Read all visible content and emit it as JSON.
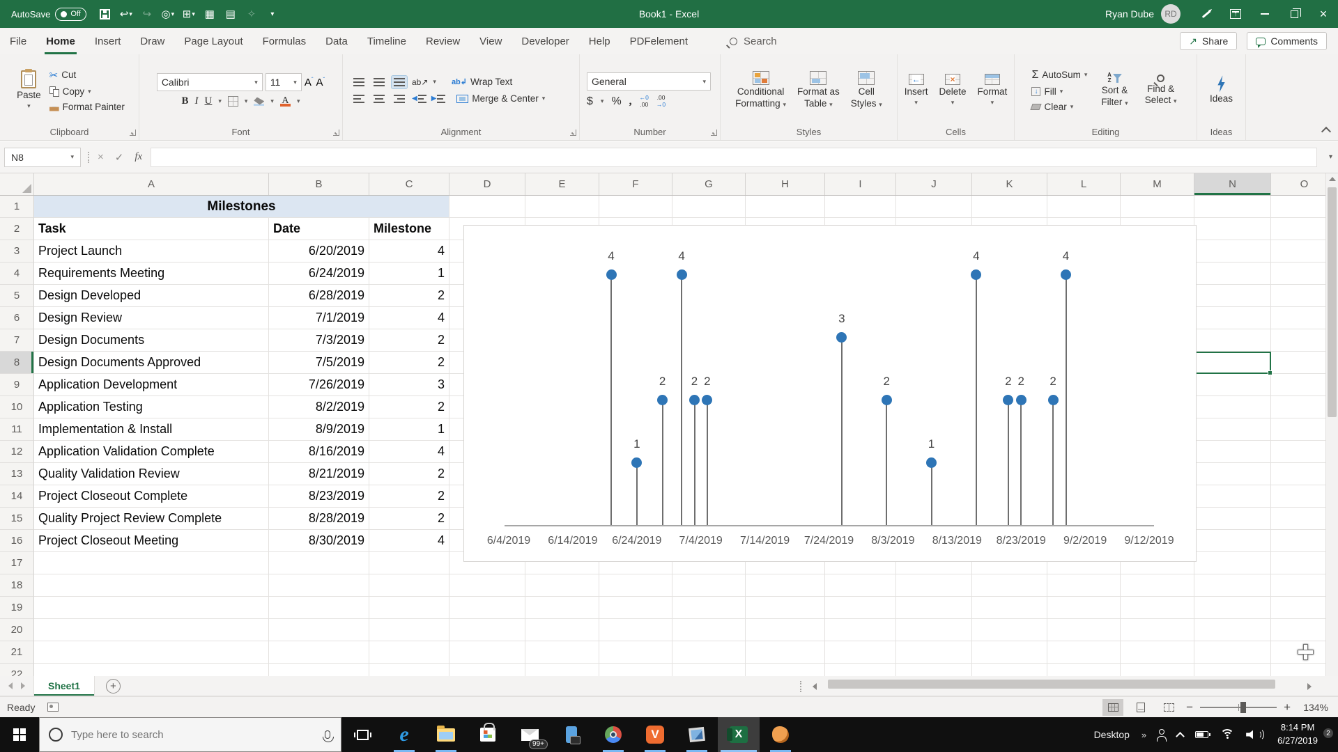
{
  "titlebar": {
    "autosave": "AutoSave",
    "autosave_state": "Off",
    "title": "Book1 - Excel",
    "user": "Ryan Dube",
    "initials": "RD"
  },
  "tabs": {
    "items": [
      {
        "label": "File"
      },
      {
        "label": "Home",
        "active": true
      },
      {
        "label": "Insert"
      },
      {
        "label": "Draw"
      },
      {
        "label": "Page Layout"
      },
      {
        "label": "Formulas"
      },
      {
        "label": "Data"
      },
      {
        "label": "Timeline"
      },
      {
        "label": "Review"
      },
      {
        "label": "View"
      },
      {
        "label": "Developer"
      },
      {
        "label": "Help"
      },
      {
        "label": "PDFelement"
      }
    ],
    "search_label": "Search",
    "share": "Share",
    "comments": "Comments"
  },
  "ribbon": {
    "clipboard": {
      "group": "Clipboard",
      "paste": "Paste",
      "cut": "Cut",
      "copy": "Copy",
      "format_painter": "Format Painter"
    },
    "font": {
      "group": "Font",
      "font_name": "Calibri",
      "font_size": "11"
    },
    "alignment": {
      "group": "Alignment",
      "wrap": "Wrap Text",
      "merge": "Merge & Center"
    },
    "number": {
      "group": "Number",
      "format": "General"
    },
    "styles": {
      "group": "Styles",
      "conditional_1": "Conditional",
      "conditional_2": "Formatting",
      "format_table_1": "Format as",
      "format_table_2": "Table",
      "cell_styles_1": "Cell",
      "cell_styles_2": "Styles"
    },
    "cells": {
      "group": "Cells",
      "insert": "Insert",
      "delete": "Delete",
      "format": "Format"
    },
    "editing": {
      "group": "Editing",
      "autosum": "AutoSum",
      "fill": "Fill",
      "clear": "Clear",
      "sort_1": "Sort &",
      "sort_2": "Filter",
      "find_1": "Find &",
      "find_2": "Select"
    },
    "ideas": {
      "group": "Ideas",
      "label": "Ideas"
    }
  },
  "formula_bar": {
    "name_box": "N8",
    "formula": ""
  },
  "sheet": {
    "columns": [
      "A",
      "B",
      "C",
      "D",
      "E",
      "F",
      "G",
      "H",
      "I",
      "J",
      "K",
      "L",
      "M",
      "N",
      "O"
    ],
    "active_column": "N",
    "active_row": 8,
    "active_cell": "N8",
    "visible_rows": 22,
    "title": "Milestones",
    "header_row": [
      "Task",
      "Date",
      "Milestone"
    ],
    "rows": [
      {
        "task": "Project Launch",
        "date": "6/20/2019",
        "milestone": "4"
      },
      {
        "task": "Requirements Meeting",
        "date": "6/24/2019",
        "milestone": "1"
      },
      {
        "task": "Design Developed",
        "date": "6/28/2019",
        "milestone": "2"
      },
      {
        "task": "Design Review",
        "date": "7/1/2019",
        "milestone": "4"
      },
      {
        "task": "Design Documents",
        "date": "7/3/2019",
        "milestone": "2"
      },
      {
        "task": "Design Documents Approved",
        "date": "7/5/2019",
        "milestone": "2"
      },
      {
        "task": "Application Development",
        "date": "7/26/2019",
        "milestone": "3"
      },
      {
        "task": "Application Testing",
        "date": "8/2/2019",
        "milestone": "2"
      },
      {
        "task": "Implementation & Install",
        "date": "8/9/2019",
        "milestone": "1"
      },
      {
        "task": "Application Validation Complete",
        "date": "8/16/2019",
        "milestone": "4"
      },
      {
        "task": "Quality Validation Review",
        "date": "8/21/2019",
        "milestone": "2"
      },
      {
        "task": "Project Closeout Complete",
        "date": "8/23/2019",
        "milestone": "2"
      },
      {
        "task": "Quality Project Review Complete",
        "date": "8/28/2019",
        "milestone": "2"
      },
      {
        "task": "Project Closeout Meeting",
        "date": "8/30/2019",
        "milestone": "4"
      }
    ]
  },
  "chart_data": {
    "type": "lollipop",
    "title": "",
    "x": [
      "6/20/2019",
      "6/24/2019",
      "6/28/2019",
      "7/1/2019",
      "7/3/2019",
      "7/5/2019",
      "7/26/2019",
      "8/2/2019",
      "8/9/2019",
      "8/16/2019",
      "8/21/2019",
      "8/23/2019",
      "8/28/2019",
      "8/30/2019"
    ],
    "values": [
      4,
      1,
      2,
      4,
      2,
      2,
      3,
      2,
      1,
      4,
      2,
      2,
      2,
      4
    ],
    "x_ticks": [
      "6/4/2019",
      "6/14/2019",
      "6/24/2019",
      "7/4/2019",
      "7/14/2019",
      "7/24/2019",
      "8/3/2019",
      "8/13/2019",
      "8/23/2019",
      "9/2/2019",
      "9/12/2019"
    ],
    "x_range": [
      "6/4/2019",
      "9/12/2019"
    ],
    "y_range": [
      0,
      4
    ],
    "data_labels": true,
    "grid": false,
    "legend": "none",
    "point_color": "#2e75b6",
    "stem_color": "#6e6e6e",
    "axis_color": "#a6a6a6",
    "tick_color": "#595959"
  },
  "sheet_tabs": {
    "active": "Sheet1"
  },
  "status_bar": {
    "mode": "Ready",
    "zoom_level": "134%"
  },
  "taskbar": {
    "search_placeholder": "Type here to search",
    "desktop": "Desktop",
    "overflow_chevrons": "»",
    "time": "8:14 PM",
    "date": "6/27/2019",
    "notification_count": "2",
    "app_icons": [
      {
        "name": "task-view"
      },
      {
        "name": "edge",
        "running": true
      },
      {
        "name": "file-explorer",
        "running": true
      },
      {
        "name": "microsoft-store"
      },
      {
        "name": "mail",
        "badge": "99+"
      },
      {
        "name": "your-phone"
      },
      {
        "name": "browser",
        "running": true
      },
      {
        "name": "vivaldi",
        "running": true
      },
      {
        "name": "notes",
        "running": true
      },
      {
        "name": "excel",
        "running": true,
        "active": true
      },
      {
        "name": "game",
        "running": true
      }
    ]
  }
}
